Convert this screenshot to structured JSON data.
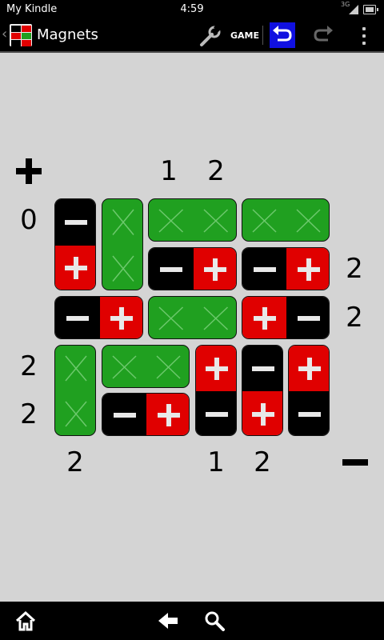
{
  "status_bar": {
    "device_name": "My Kindle",
    "time": "4:59",
    "network": "3G"
  },
  "action_bar": {
    "icons": {
      "back": "chevron-left-icon",
      "app": "magnets-app-icon",
      "settings": "wrench-icon",
      "undo": "undo-icon",
      "redo": "redo-icon",
      "overflow": "overflow-menu-icon"
    },
    "title": "Magnets",
    "game_label": "GAME"
  },
  "colors": {
    "positive": "#e00000",
    "negative": "#000000",
    "empty": "#20a020",
    "background": "#d4d4d4",
    "undo_highlight": "#1010e0"
  },
  "board": {
    "rows": 5,
    "cols": 6,
    "top_plus_clues": [
      "",
      "",
      "1",
      "2",
      "",
      ""
    ],
    "left_plus_clues": [
      "0",
      "",
      "",
      "2",
      "2"
    ],
    "right_minus_clues": [
      "",
      "2",
      "2",
      "",
      ""
    ],
    "bottom_minus_clues": [
      "2",
      "",
      "",
      "1",
      "2",
      ""
    ],
    "grid": [
      [
        "-",
        "x",
        "x",
        "x",
        "x",
        "x"
      ],
      [
        "+",
        "x",
        "-",
        "+",
        "-",
        "+"
      ],
      [
        "-",
        "+",
        "x",
        "x",
        "+",
        "-"
      ],
      [
        "x",
        "x",
        "x",
        "+",
        "-",
        "+"
      ],
      [
        "x",
        "-",
        "+",
        "-",
        "+",
        "-"
      ]
    ],
    "dominoes": [
      [
        [
          0,
          0
        ],
        [
          1,
          0
        ]
      ],
      [
        [
          0,
          1
        ],
        [
          1,
          1
        ]
      ],
      [
        [
          0,
          2
        ],
        [
          0,
          3
        ]
      ],
      [
        [
          0,
          4
        ],
        [
          0,
          5
        ]
      ],
      [
        [
          1,
          2
        ],
        [
          1,
          3
        ]
      ],
      [
        [
          1,
          4
        ],
        [
          1,
          5
        ]
      ],
      [
        [
          2,
          0
        ],
        [
          2,
          1
        ]
      ],
      [
        [
          2,
          2
        ],
        [
          2,
          3
        ]
      ],
      [
        [
          2,
          4
        ],
        [
          2,
          5
        ]
      ],
      [
        [
          3,
          0
        ],
        [
          4,
          0
        ]
      ],
      [
        [
          3,
          1
        ],
        [
          3,
          2
        ]
      ],
      [
        [
          3,
          3
        ],
        [
          4,
          3
        ]
      ],
      [
        [
          3,
          4
        ],
        [
          4,
          4
        ]
      ],
      [
        [
          3,
          5
        ],
        [
          4,
          5
        ]
      ],
      [
        [
          4,
          1
        ],
        [
          4,
          2
        ]
      ]
    ]
  },
  "bottom_bar": {
    "icons": [
      "home-icon",
      "back-arrow-icon",
      "search-icon"
    ]
  }
}
